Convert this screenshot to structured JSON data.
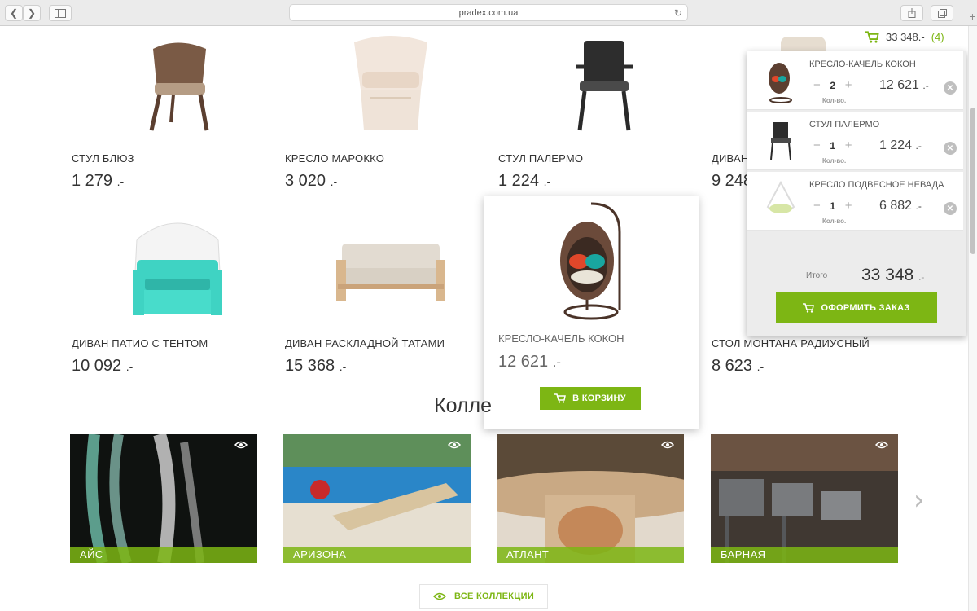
{
  "browser": {
    "url": "pradex.com.ua"
  },
  "cart_header": {
    "total": "33 348.-",
    "count": "(4)"
  },
  "products": [
    {
      "name": "СТУЛ БЛЮЗ",
      "price": "1 279",
      "currency": ".-"
    },
    {
      "name": "КРЕСЛО МАРОККО",
      "price": "3 020",
      "currency": ".-"
    },
    {
      "name": "СТУЛ ПАЛЕРМО",
      "price": "1 224",
      "currency": ".-"
    },
    {
      "name": "ДИВАН",
      "price": "9 248",
      "currency": ""
    },
    {
      "name": "ДИВАН ПАТИО С ТЕНТОМ",
      "price": "10 092",
      "currency": ".-"
    },
    {
      "name": "ДИВАН РАСКЛАДНОЙ ТАТАМИ",
      "price": "15 368",
      "currency": ".-"
    },
    {
      "name": "КРЕСЛО-КАЧЕЛЬ КОКОН",
      "price": "12 621",
      "currency": ".-",
      "button": "В КОРЗИНУ"
    },
    {
      "name": "СТОЛ МОНТАНА РАДИУСНЫЙ",
      "price": "8 623",
      "currency": ".-"
    }
  ],
  "collections": {
    "title": "Колле",
    "items": [
      "АЙС",
      "АРИЗОНА",
      "АТЛАНТ",
      "БАРНАЯ"
    ],
    "all_button": "ВСЕ КОЛЛЕКЦИИ"
  },
  "cart": {
    "items": [
      {
        "name": "КРЕСЛО-КАЧЕЛЬ КОКОН",
        "qty": "2",
        "qty_label": "Кол-во.",
        "price": "12 621",
        "currency": ".-"
      },
      {
        "name": "СТУЛ ПАЛЕРМО",
        "qty": "1",
        "qty_label": "Кол-во.",
        "price": "1 224",
        "currency": ".-"
      },
      {
        "name": "КРЕСЛО ПОДВЕСНОЕ НЕВАДА",
        "qty": "1",
        "qty_label": "Кол-во.",
        "price": "6 882",
        "currency": ".-"
      }
    ],
    "total_label": "Итого",
    "total": "33 348",
    "total_currency": ".-",
    "checkout": "ОФОРМИТЬ ЗАКАЗ"
  },
  "colors": {
    "accent": "#7db614"
  }
}
